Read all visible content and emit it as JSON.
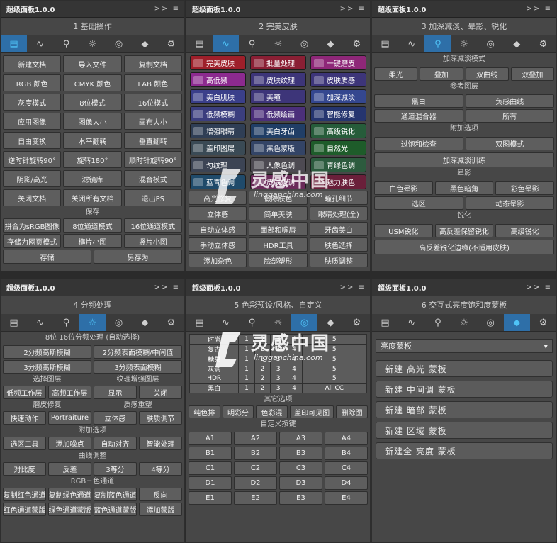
{
  "panel_title": "超级面板1.0.0",
  "collapse_glyph": ">> ≡",
  "tab_icons": [
    "document-icon",
    "pulse-icon",
    "search-icon",
    "sun-icon",
    "color-circles-icon",
    "diamond-icon",
    "gear-icon"
  ],
  "tab_glyphs": [
    "▤",
    "∿",
    "⚲",
    "☼",
    "◎",
    "◆",
    "⚙"
  ],
  "p1": {
    "heading": "1 基础操作",
    "rows": [
      [
        "新建文档",
        "导入文件",
        "复制文档"
      ],
      [
        "RGB 颜色",
        "CMYK 颜色",
        "LAB 颜色"
      ],
      [
        "灰度模式",
        "8位模式",
        "16位模式"
      ],
      [
        "应用图像",
        "图像大小",
        "画布大小"
      ],
      [
        "自由变换",
        "水平翻转",
        "垂直翻转"
      ],
      [
        "逆时针旋转90°",
        "旋转180°",
        "顺时针旋转90°"
      ],
      [
        "阴影/高光",
        "滤镜库",
        "混合模式"
      ],
      [
        "关闭文档",
        "关闭所有文档",
        "退出PS"
      ]
    ],
    "save_label": "保存",
    "save_rows": [
      [
        "拼合为sRGB图像",
        "8位通道模式",
        "16位通道模式"
      ],
      [
        "存储为网页模式",
        "横片小图",
        "竖片小图"
      ]
    ],
    "last": [
      "存储",
      "另存为"
    ]
  },
  "p2": {
    "heading": "2 完美皮肤",
    "colored": [
      [
        "完美皮肤",
        "批量处理",
        "一键磨皮"
      ],
      [
        "高低频",
        "皮肤纹理",
        "皮肤质感"
      ],
      [
        "美白肌肤",
        "美瞳",
        "加深减淡"
      ],
      [
        "低频模糊",
        "低频绘画",
        "智能修复"
      ],
      [
        "增强眼睛",
        "美白牙齿",
        "高级锐化"
      ],
      [
        "盖印图层",
        "黑色蒙版",
        "自然光"
      ],
      [
        "匀纹理",
        "人像色调",
        "青绿色调"
      ],
      [
        "蓝青色调",
        "皮肤色调",
        "魅力肤色"
      ]
    ],
    "colors": [
      [
        "#9e1f2a",
        "#8a1f34",
        "#8e2778"
      ],
      [
        "#8c2a8f",
        "#3d3579",
        "#3d3579"
      ],
      [
        "#3a3f8a",
        "#3d3579",
        "#34478f"
      ],
      [
        "#3b3e7e",
        "#4b2f7a",
        "#25356f"
      ],
      [
        "#2f3e55",
        "#203e66",
        "#265c3a"
      ],
      [
        "#3a4a55",
        "#334466",
        "#1e5c2a"
      ],
      [
        "#3c4454",
        "#4d4a52",
        "#2c5b3e"
      ],
      [
        "#1f4a6a",
        "#6a2c5a",
        "#6a1f3a"
      ]
    ],
    "rows": [
      [
        "高光修复",
        "锻除肤色",
        "瞳孔细节"
      ],
      [
        "立体感",
        "简单美肤",
        "眼睛处理(全)"
      ],
      [
        "自动立体感",
        "面部和嘴唇",
        "牙齿美白"
      ],
      [
        "手动立体感",
        "HDR工具",
        "肤色选择"
      ],
      [
        "添加杂色",
        "脸部塑形",
        "肤质调整"
      ]
    ]
  },
  "p3": {
    "heading": "3 加深减淡、晕影、锐化",
    "s1": "加深减淡模式",
    "r1": [
      "柔光",
      "叠加",
      "双曲线",
      "双叠加"
    ],
    "s2": "参考图层",
    "r2": [
      [
        "黑白",
        "负感曲线"
      ],
      [
        "通道混合器",
        "所有"
      ]
    ],
    "s3": "附加选项",
    "r3": [
      [
        "过饱和检查",
        "双图模式"
      ]
    ],
    "r3b": "加深减淡训练",
    "s4": "晕影",
    "r4": [
      [
        "白色晕影",
        "黑色暗角",
        "彩色晕影"
      ]
    ],
    "r4b": [
      "选区",
      "动态晕影"
    ],
    "s5": "锐化",
    "r5": [
      "USM锐化",
      "高反差保留锐化",
      "高级锐化"
    ],
    "r5b": "高反差锐化边缘(不适用皮肤)"
  },
  "p4": {
    "heading": "4 分频处理",
    "s1": "8位 16位分频处理 (自动选择)",
    "r1": [
      [
        "2分频高斯模糊",
        "2分频表面模糊/中间值"
      ],
      [
        "3分频高斯模糊",
        "3分频表面模糊"
      ]
    ],
    "s2a": "选择图层",
    "s2b": "纹理增强图层",
    "r2": [
      "低频工作层",
      "高频工作层",
      "显示",
      "关闭"
    ],
    "s3a": "磨皮修复",
    "s3b": "质感重塑",
    "r3": [
      "快速动作",
      "Portraiture",
      "立体感",
      "肤质调节"
    ],
    "s4": "附加选项",
    "r4": [
      "选区工具",
      "添加噪点",
      "自动对齐",
      "智能处理"
    ],
    "s5": "曲线调整",
    "r5": [
      "对比度",
      "反差",
      "3等分",
      "4等分"
    ],
    "s6": "RGB三色通道",
    "r6": [
      "复制红色通道",
      "复制绿色通道",
      "复制蓝色通道",
      "反向"
    ],
    "r7": [
      "红色通道蒙版",
      "绿色通道蒙版",
      "蓝色通道蒙版",
      "添加蒙版"
    ]
  },
  "p5": {
    "heading": "5 色彩预设/风格、自定义",
    "matrix": [
      [
        "时尚",
        "1",
        "2",
        "3",
        "4",
        "5"
      ],
      [
        "复古",
        "1",
        "2",
        "3",
        "4",
        "5"
      ],
      [
        "糖果",
        "1",
        "2",
        "3",
        "4",
        "5"
      ],
      [
        "灰调",
        "1",
        "2",
        "3",
        "4",
        "5"
      ],
      [
        "HDR",
        "1",
        "2",
        "3",
        "4",
        "5"
      ],
      [
        "黑白",
        "1",
        "2",
        "3",
        "4",
        "All CC"
      ]
    ],
    "s1": "其它选项",
    "r1": [
      "纯色排",
      "明彩分",
      "色彩混",
      "盖印可见图",
      "删除图"
    ],
    "s2": "自定义按键",
    "keys": [
      [
        "A1",
        "A2",
        "A3",
        "A4"
      ],
      [
        "B1",
        "B2",
        "B3",
        "B4"
      ],
      [
        "C1",
        "C2",
        "C3",
        "C4"
      ],
      [
        "D1",
        "D2",
        "D3",
        "D4"
      ],
      [
        "E1",
        "E2",
        "E3",
        "E4"
      ]
    ]
  },
  "p6": {
    "heading": "6 交互式亮度饱和度蒙板",
    "select": "亮度蒙板",
    "select_arrow": "▾",
    "buttons": [
      "新建 高光 蒙板",
      "新建 中间调 蒙板",
      "新建 暗部 蒙板",
      "新建 区域 蒙板",
      "新建全 亮度 蒙板"
    ]
  },
  "watermark": {
    "title": "灵感中国",
    "url": "lingganchina.com"
  }
}
